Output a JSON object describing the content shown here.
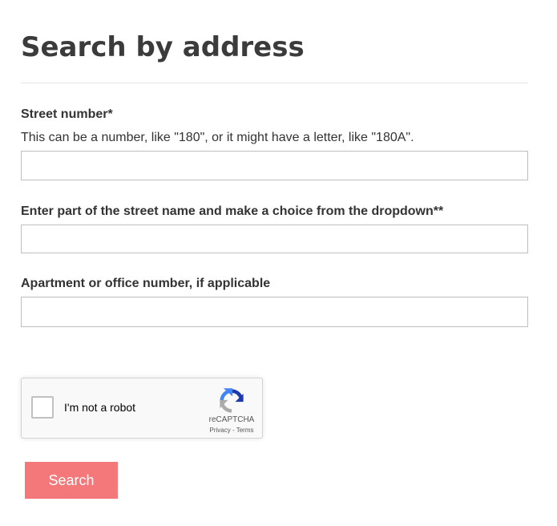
{
  "page": {
    "title": "Search by address"
  },
  "form": {
    "street_number": {
      "label": "Street number*",
      "hint": "This can be a number, like \"180\", or it might have a letter, like \"180A\".",
      "value": ""
    },
    "street_name": {
      "label": "Enter part of the street name and make a choice from the dropdown**",
      "value": ""
    },
    "apartment": {
      "label": "Apartment or office number, if applicable",
      "value": ""
    }
  },
  "captcha": {
    "label": "I'm not a robot",
    "brand": "reCAPTCHA",
    "privacy": "Privacy",
    "separator": "-",
    "terms": "Terms",
    "checked": false,
    "logo_icon": "recaptcha-logo-icon"
  },
  "search_button": {
    "label": "Search"
  },
  "colors": {
    "button": "#f4787a",
    "text": "#333333",
    "title": "#3b3b3b",
    "recaptcha_blue": "#1c3aa9",
    "recaptcha_lightblue": "#4285f4",
    "recaptcha_gray": "#ababab"
  }
}
